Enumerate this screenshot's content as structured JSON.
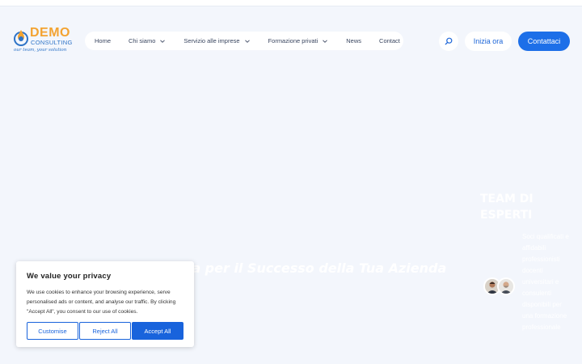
{
  "logo": {
    "title": "DEMO",
    "subtitle": "CONSULTING",
    "tagline": "our team, your solution"
  },
  "nav": {
    "items": [
      {
        "label": "Home",
        "dropdown": false
      },
      {
        "label": "Chi siamo",
        "dropdown": true
      },
      {
        "label": "Servizio alle imprese",
        "dropdown": true
      },
      {
        "label": "Formazione privati",
        "dropdown": true
      },
      {
        "label": "News",
        "dropdown": false
      },
      {
        "label": "Contact",
        "dropdown": false
      }
    ]
  },
  "header": {
    "start_label": "Inizia ora",
    "contact_label": "Contattaci"
  },
  "hero": {
    "text": "za per il Successo della Tua Azienda"
  },
  "team": {
    "title": "TEAM DI ESPERTI",
    "description": "Soci qualificati e affidabili professionisti docenti universitari e consulenti disponibili per una formazione professionale"
  },
  "cookie": {
    "title": "We value your privacy",
    "text": "We use cookies to enhance your browsing experience, serve personalised ads or content, and analyse our traffic. By clicking \"Accept All\", you consent to our use of cookies.",
    "customise_label": "Customise",
    "reject_label": "Reject All",
    "accept_label": "Accept All"
  },
  "colors": {
    "accent": "#1d6fe8",
    "logo_orange": "#f3a331",
    "logo_blue": "#2d73c7",
    "background": "#f3f6fc"
  }
}
